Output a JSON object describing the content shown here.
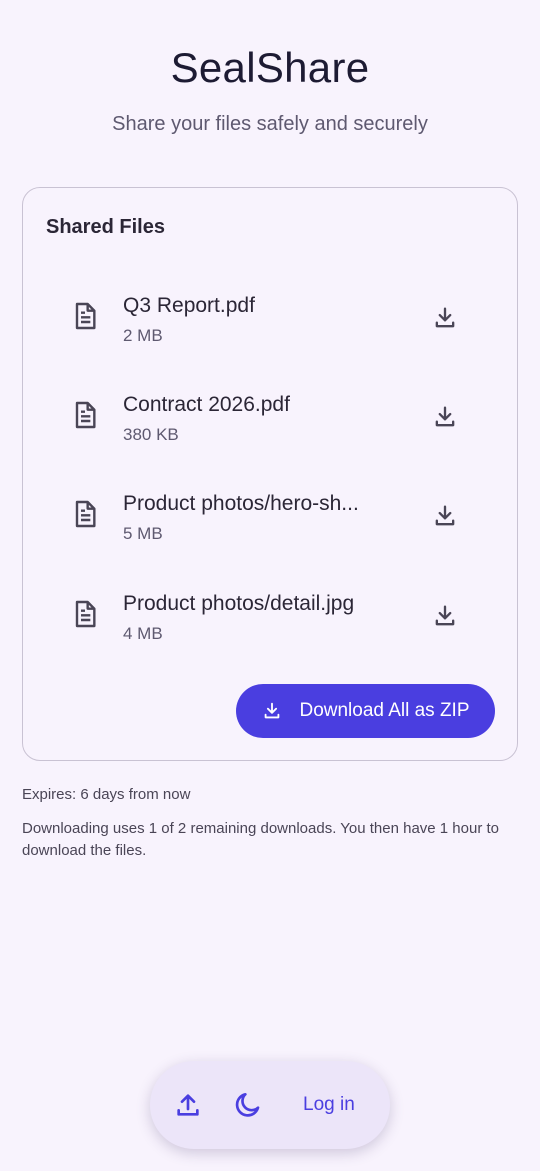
{
  "header": {
    "title": "SealShare",
    "subtitle": "Share your files safely and securely"
  },
  "files_card": {
    "title": "Shared Files",
    "files": [
      {
        "name": "Q3 Report.pdf",
        "size": "2 MB"
      },
      {
        "name": "Contract 2026.pdf",
        "size": "380 KB"
      },
      {
        "name": "Product photos/hero-sh...",
        "size": "5 MB"
      },
      {
        "name": "Product photos/detail.jpg",
        "size": "4 MB"
      }
    ],
    "download_all_label": "Download All as ZIP"
  },
  "info": {
    "expires": "Expires: 6 days from now",
    "note": "Downloading uses 1 of 2 remaining downloads. You then have 1 hour to download the files."
  },
  "bottom_bar": {
    "login_label": "Log in"
  },
  "colors": {
    "background": "#f8f3fd",
    "accent": "#4a3ee0",
    "card_border": "#c9c2d3"
  },
  "icons": [
    "document-icon",
    "download-icon",
    "upload-icon",
    "moon-icon"
  ]
}
